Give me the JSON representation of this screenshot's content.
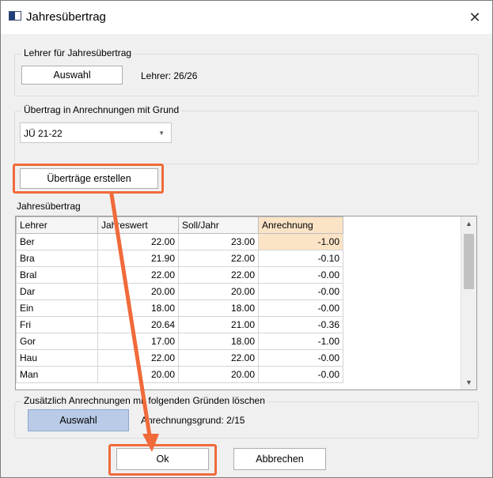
{
  "window": {
    "title": "Jahresübertrag",
    "icon": "app-window-icon",
    "close_glyph": "✕"
  },
  "teacher_group": {
    "title": "Lehrer für Jahresübertrag",
    "select_button": "Auswahl",
    "status": "Lehrer: 26/26"
  },
  "transfer_group": {
    "title": "Übertrag in Anrechnungen mit Grund",
    "reason_value": "JÜ 21-22"
  },
  "create_button": "Überträge erstellen",
  "grid": {
    "title": "Jahresübertrag",
    "columns": [
      "Lehrer",
      "Jahreswert",
      "Soll/Jahr",
      "Anrechnung"
    ],
    "rows": [
      [
        "Ber",
        "22.00",
        "23.00",
        "-1.00"
      ],
      [
        "Bra",
        "21.90",
        "22.00",
        "-0.10"
      ],
      [
        "Bral",
        "22.00",
        "22.00",
        "-0.00"
      ],
      [
        "Dar",
        "20.00",
        "20.00",
        "-0.00"
      ],
      [
        "Ein",
        "18.00",
        "18.00",
        "-0.00"
      ],
      [
        "Fri",
        "20.64",
        "21.00",
        "-0.36"
      ],
      [
        "Gor",
        "17.00",
        "18.00",
        "-1.00"
      ],
      [
        "Hau",
        "22.00",
        "22.00",
        "-0.00"
      ],
      [
        "Man",
        "20.00",
        "20.00",
        "-0.00"
      ]
    ]
  },
  "delete_group": {
    "title": "Zusätzlich Anrechnungen mit folgenden Gründen löschen",
    "select_button": "Auswahl",
    "status": "Anrechnungsgrund: 2/15"
  },
  "footer": {
    "ok": "Ok",
    "cancel": "Abbrechen"
  },
  "accent_color": "#f06a3a",
  "selection_color": "#fbe3c6"
}
